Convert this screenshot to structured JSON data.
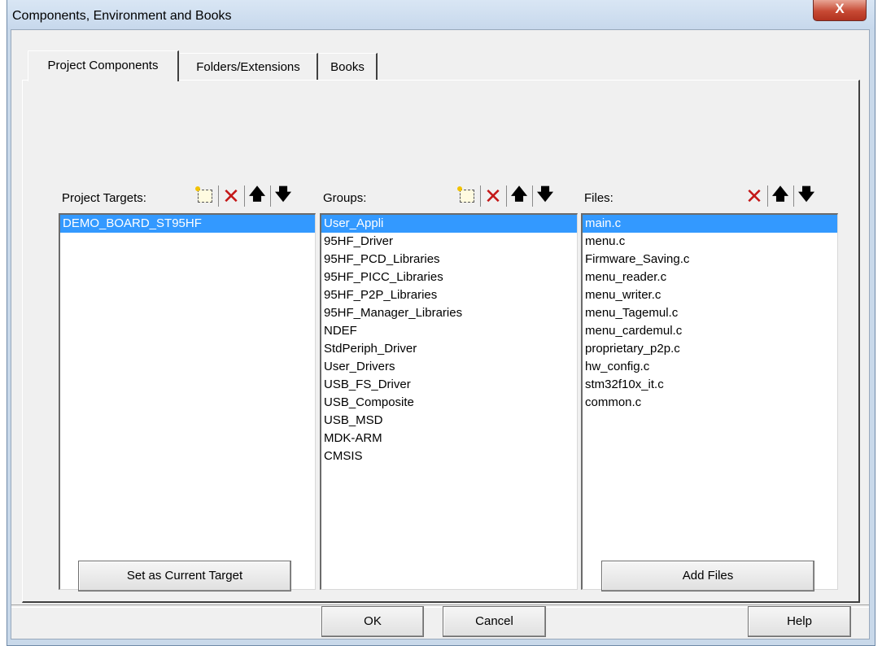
{
  "window": {
    "title": "Components, Environment and Books",
    "close_glyph": "X"
  },
  "tabs": [
    "Project Components",
    "Folders/Extensions",
    "Books"
  ],
  "targets": {
    "label": "Project Targets:",
    "items": [
      "DEMO_BOARD_ST95HF"
    ],
    "selected_index": 0
  },
  "groups": {
    "label": "Groups:",
    "items": [
      "User_Appli",
      "95HF_Driver",
      "95HF_PCD_Libraries",
      "95HF_PICC_Libraries",
      "95HF_P2P_Libraries",
      "95HF_Manager_Libraries",
      "NDEF",
      "StdPeriph_Driver",
      "User_Drivers",
      "USB_FS_Driver",
      "USB_Composite",
      "USB_MSD",
      "MDK-ARM",
      "CMSIS"
    ],
    "selected_index": 0
  },
  "files": {
    "label": "Files:",
    "items": [
      "main.c",
      "menu.c",
      "Firmware_Saving.c",
      "menu_reader.c",
      "menu_writer.c",
      "menu_Tagemul.c",
      "menu_cardemul.c",
      "proprietary_p2p.c",
      "hw_config.c",
      "stm32f10x_it.c",
      "common.c"
    ],
    "selected_index": 0
  },
  "icons": {
    "new": "new-item-icon",
    "delete": "delete-icon",
    "move_up": "arrow-up-icon",
    "move_down": "arrow-down-icon",
    "up_glyph": "🡅",
    "down_glyph": "🡇",
    "delete_glyph": "✕"
  },
  "buttons": {
    "set_target": "Set as Current Target",
    "add_files": "Add Files",
    "ok": "OK",
    "cancel": "Cancel",
    "help": "Help"
  },
  "colors": {
    "selection": "#3399ff",
    "delete_icon": "#c41818",
    "close_button": "#c74a34"
  }
}
